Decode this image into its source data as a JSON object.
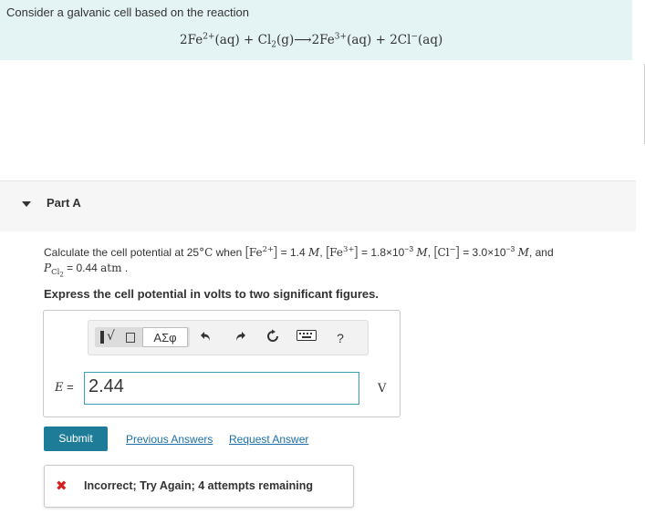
{
  "intro": {
    "prompt": "Consider a galvanic cell based on the reaction",
    "reaction": {
      "coef1": "2Fe",
      "charge1": "2+",
      "phase1": "(aq)",
      "plus1": " + ",
      "cl": "Cl",
      "cl_sub": "2",
      "phase2": "(g)",
      "arrow": "⟶",
      "coef2": "2Fe",
      "charge2": "3+",
      "phase3": "(aq)",
      "plus2": " + ",
      "coef3": "2Cl",
      "charge3": "−",
      "phase4": "(aq)"
    }
  },
  "part": {
    "title": "Part A"
  },
  "question": {
    "line1_a": "Calculate the cell potential at 25",
    "deg": "°",
    "unit_c": "C",
    "line1_b": " when ",
    "fe2_label": "Fe",
    "fe2_charge": "2+",
    "fe2_value": " = 1.4 ",
    "M1": "M",
    "sep1": ", ",
    "fe3_label": "Fe",
    "fe3_charge": "3+",
    "fe3_value": " = 1.8×10",
    "fe3_exp": "−3",
    "M2": "M",
    "sep2": ", ",
    "cl_label": "Cl",
    "cl_charge": "−",
    "cl_value": " = 3.0×10",
    "cl_exp": "−3",
    "M3": "M",
    "line1_c": ", and",
    "p_label": "P",
    "p_sub": "Cl",
    "p_sub2": "2",
    "p_value": " = 0.44 ",
    "atm": "atm",
    "period": " .",
    "instruction": "Express the cell potential in volts to two significant figures."
  },
  "answer": {
    "toolbar": {
      "templates_sqrt": "√",
      "greek": "ΑΣφ",
      "undo_icon": "undo-icon",
      "redo_icon": "redo-icon",
      "reset_icon": "reset-icon",
      "keyboard_icon": "keyboard-icon",
      "help": "?"
    },
    "variable": "E",
    "equals": " =",
    "value": "2.44",
    "unit": "V"
  },
  "actions": {
    "submit": "Submit",
    "previous_answers": "Previous Answers",
    "request_answer": "Request Answer"
  },
  "feedback": {
    "icon": "✖",
    "message": "Incorrect; Try Again; 4 attempts remaining"
  },
  "colors": {
    "intro_bg": "#e4f3f3",
    "submit_bg": "#1f7c99",
    "link": "#1c6fa8",
    "error": "#d61f1f",
    "input_border": "#3b9fb2"
  }
}
